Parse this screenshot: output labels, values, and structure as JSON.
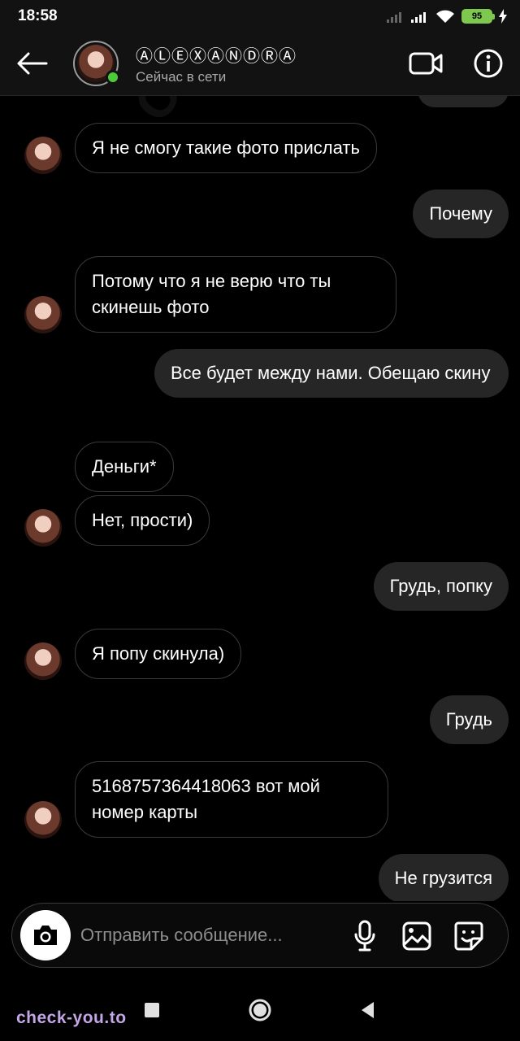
{
  "status_bar": {
    "time": "18:58",
    "battery": "95"
  },
  "header": {
    "contact_name": "ⒶⓁⒺⓍⒶⓃⒹⓇⒶ",
    "contact_status": "Сейчас в сети",
    "icons": {
      "back": "arrow-left-icon",
      "video": "video-camera-icon",
      "info": "info-icon"
    }
  },
  "messages": [
    {
      "dir": "out",
      "text": ""
    },
    {
      "dir": "in",
      "text": "Я не смогу такие фото прислать"
    },
    {
      "dir": "out",
      "text": "Почему"
    },
    {
      "dir": "in",
      "text": "Потому что я не верю что ты скинешь фото"
    },
    {
      "dir": "out",
      "text": "Все будет между нами. Обещаю скину"
    },
    {
      "dir": "in",
      "text": "Деньги*"
    },
    {
      "dir": "in",
      "text": "Нет, прости)"
    },
    {
      "dir": "out",
      "text": "Грудь, попку"
    },
    {
      "dir": "in",
      "text": "Я попу скинула)"
    },
    {
      "dir": "out",
      "text": "Грудь"
    },
    {
      "dir": "in",
      "text": "5168757364418063 вот мой номер карты"
    },
    {
      "dir": "out",
      "text": "Не грузится"
    }
  ],
  "composer": {
    "placeholder": "Отправить сообщение...",
    "icons": {
      "camera": "camera-icon",
      "mic": "microphone-icon",
      "gallery": "image-icon",
      "sticker": "sticker-icon"
    }
  },
  "watermarks": {
    "diagonal": "CHECK-YOU.ME",
    "footer": "check-you.to"
  },
  "colors": {
    "background": "#000000",
    "outgoing_bubble": "#262626",
    "online": "#4ccb3a",
    "battery": "#7ec850",
    "footer_watermark": "#c3a6e6"
  }
}
